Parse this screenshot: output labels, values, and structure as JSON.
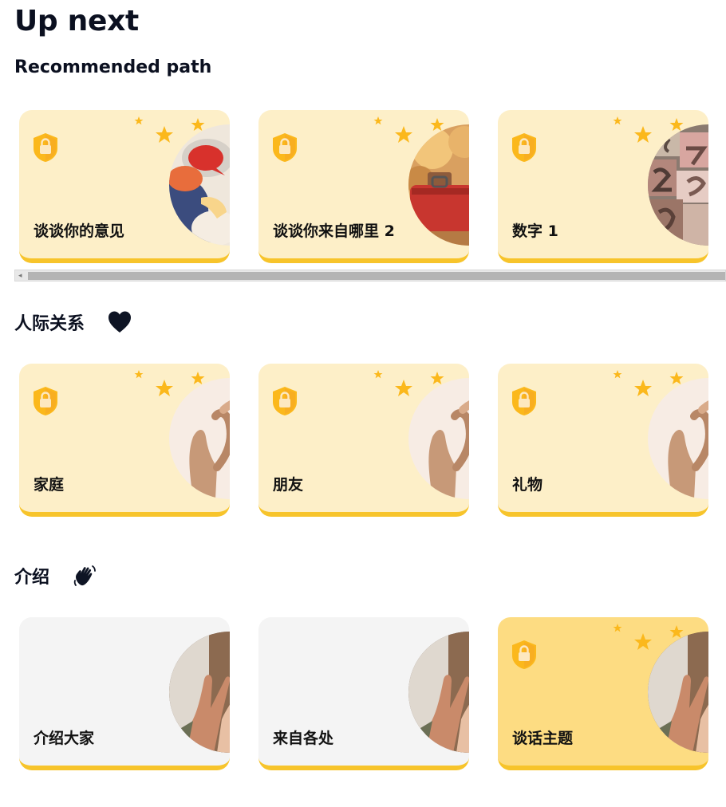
{
  "page": {
    "title": "Up next"
  },
  "sections": [
    {
      "heading": "Recommended path",
      "emoji": "",
      "cards": [
        {
          "label": "谈谈你的意见",
          "style": "light",
          "locked": true,
          "stars": true,
          "image": "speech-bubble-illustration"
        },
        {
          "label": "谈谈你来自哪里 2",
          "style": "light",
          "locked": true,
          "stars": true,
          "image": "red-suitcase-photo"
        },
        {
          "label": "数字 1",
          "style": "light",
          "locked": true,
          "stars": true,
          "image": "printing-numbers-photo"
        }
      ]
    },
    {
      "heading": "人际关系",
      "emoji": "black-heart-icon",
      "cards": [
        {
          "label": "家庭",
          "style": "light",
          "locked": true,
          "stars": true,
          "image": "heart-hands-photo"
        },
        {
          "label": "朋友",
          "style": "light",
          "locked": true,
          "stars": true,
          "image": "heart-hands-photo"
        },
        {
          "label": "礼物",
          "style": "light",
          "locked": true,
          "stars": true,
          "image": "heart-hands-photo"
        }
      ]
    },
    {
      "heading": "介绍",
      "emoji": "waving-hand-icon",
      "cards": [
        {
          "label": "介绍大家",
          "style": "grey",
          "locked": false,
          "stars": false,
          "image": "high-five-photo"
        },
        {
          "label": "来自各处",
          "style": "grey",
          "locked": false,
          "stars": false,
          "image": "high-five-photo"
        },
        {
          "label": "谈话主题",
          "style": "gold",
          "locked": true,
          "stars": true,
          "image": "high-five-photo"
        }
      ]
    }
  ],
  "colors": {
    "card_light": "#fdefc8",
    "card_grey": "#f4f4f4",
    "card_gold": "#fddc82",
    "accent": "#f7c42b",
    "star": "#fbb81c",
    "lock_shield": "#fbb81c"
  }
}
